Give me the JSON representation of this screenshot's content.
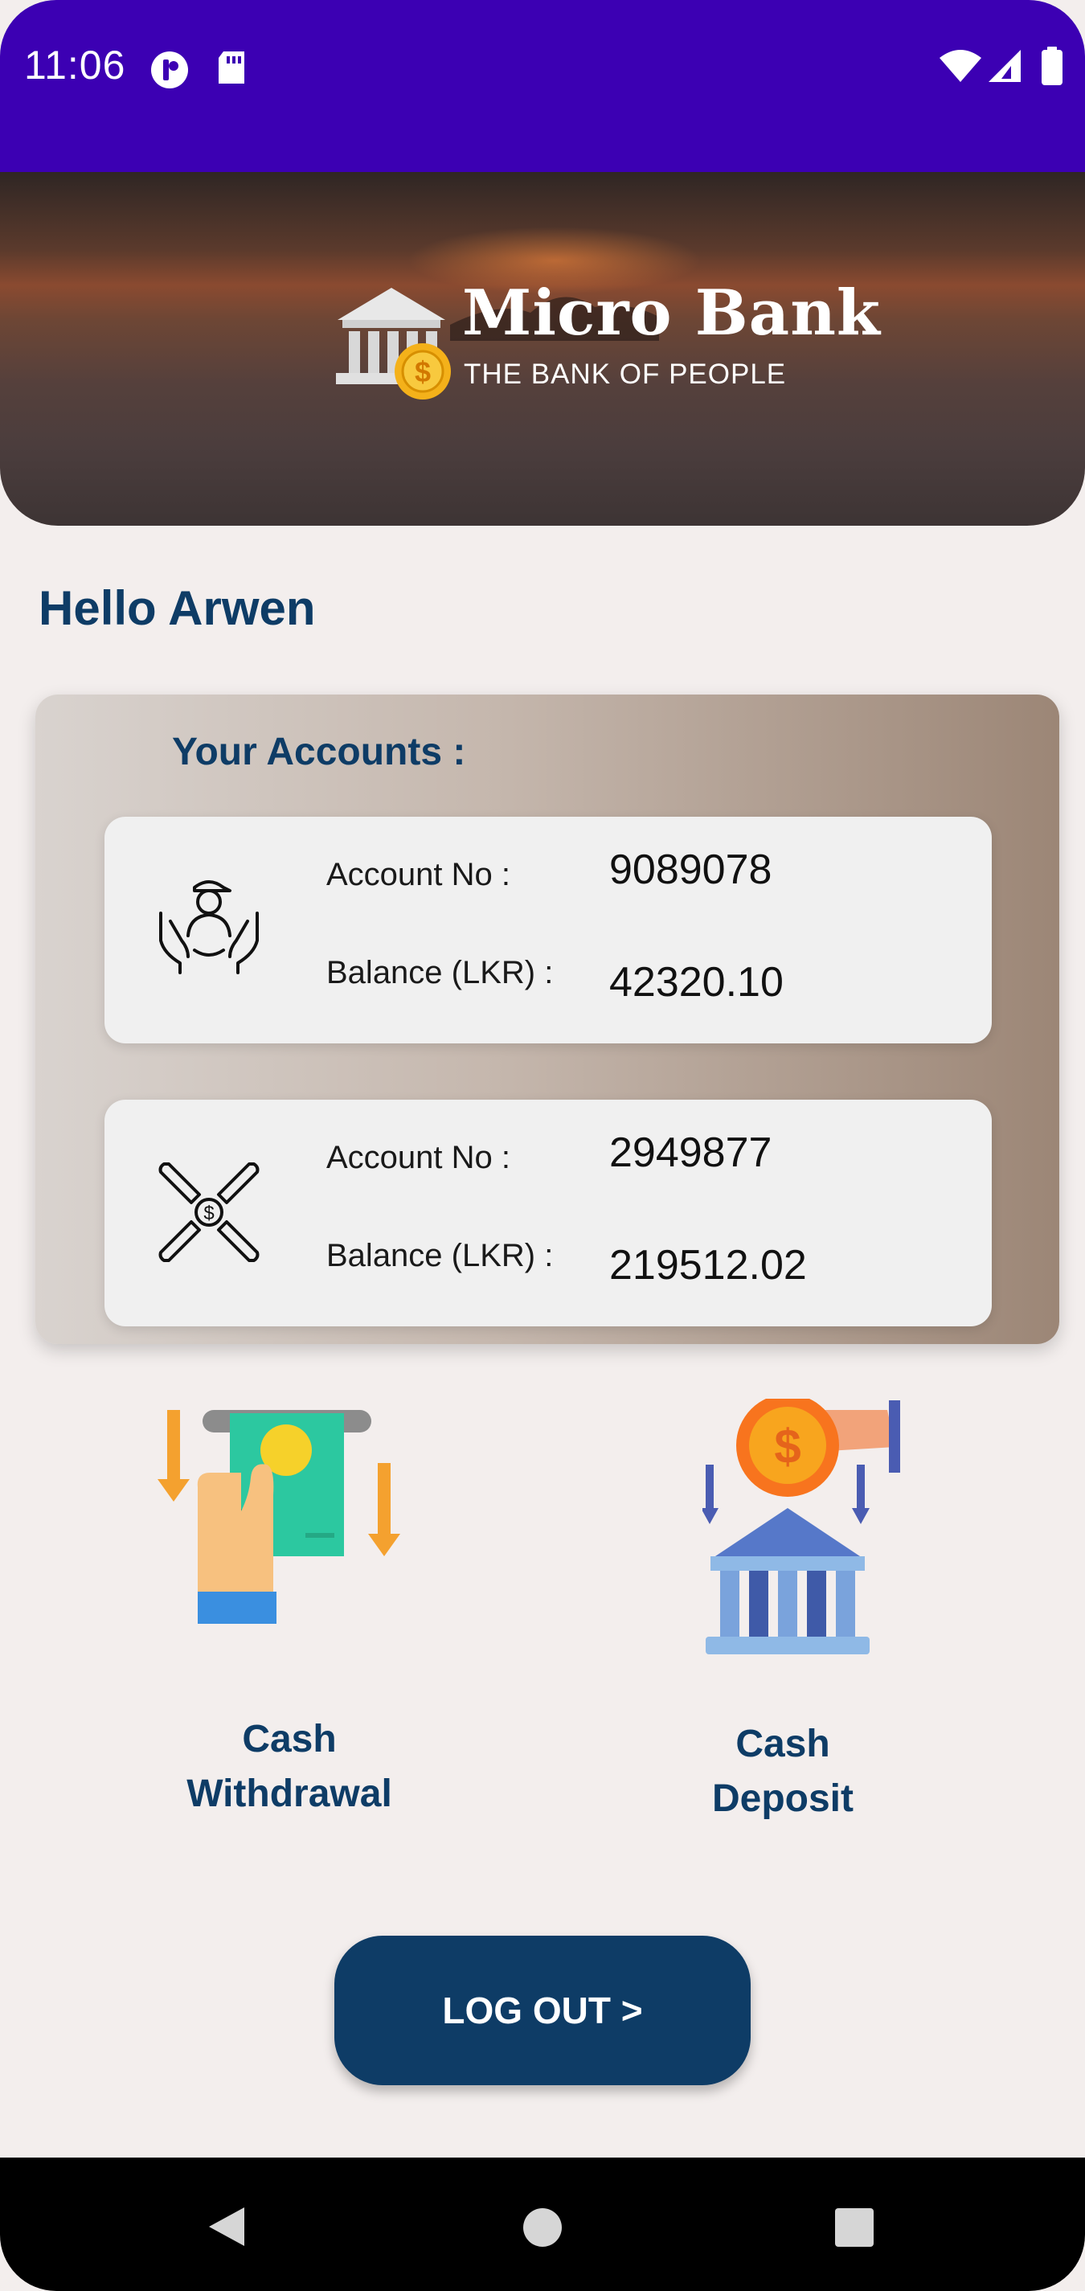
{
  "status_bar": {
    "time": "11:06",
    "icons": [
      "privacy-indicator-icon",
      "sd-card-icon",
      "wifi-icon",
      "cell-signal-icon",
      "battery-icon"
    ]
  },
  "banner": {
    "brand_name": "Micro Bank",
    "tagline": "THE BANK OF PEOPLE"
  },
  "greeting": "Hello Arwen",
  "accounts": {
    "title": "Your Accounts :",
    "items": [
      {
        "icon": "hands-person-icon",
        "account_label": "Account No :",
        "account_no": "9089078",
        "balance_label": "Balance (LKR) :",
        "balance": "42320.10"
      },
      {
        "icon": "hands-coin-icon",
        "account_label": "Account No :",
        "account_no": "2949877",
        "balance_label": "Balance (LKR) :",
        "balance": "219512.02"
      }
    ]
  },
  "services": [
    {
      "label": "Cash\nWithdrawal",
      "icon": "cash-withdrawal-icon"
    },
    {
      "label": "Cash\nDeposit",
      "icon": "cash-deposit-icon"
    }
  ],
  "logout_label": "LOG OUT >",
  "nav": {
    "icons": [
      "back-icon",
      "home-icon",
      "recents-icon"
    ]
  },
  "colors": {
    "status_bar": "#3c00b3",
    "primary": "#0e3c66",
    "background": "#f3eeed"
  }
}
